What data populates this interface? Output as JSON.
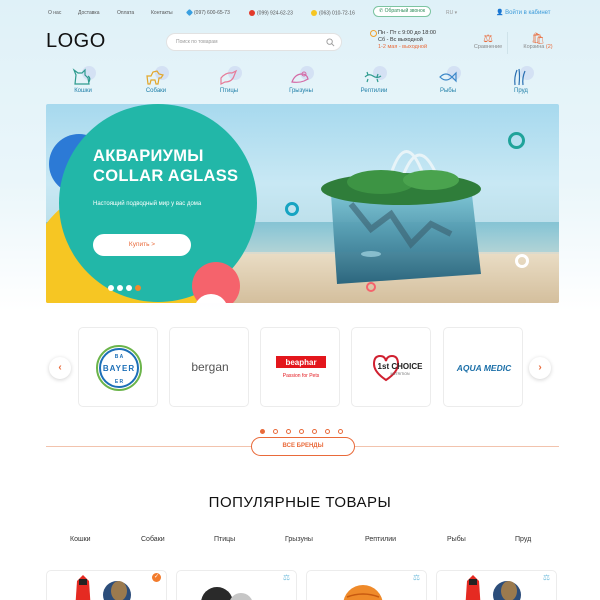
{
  "topbar": {
    "links": [
      "О нас",
      "Доставка",
      "Оплата",
      "Контакты"
    ],
    "phones": [
      "(097) 600-65-73",
      "(099) 924-62-23",
      "(063) 010-72-16"
    ],
    "callback": "Обратный звонок",
    "lang": "RU",
    "login": "Войти в кабинет"
  },
  "header": {
    "logo": "LOGO",
    "search_placeholder": "Поиск по товарам",
    "hours": [
      "Пн - Пт с 9:00 до 18:00",
      "Сб - Вс выходной"
    ],
    "hours_note": "1-2 мая - выходной",
    "compare_label": "Сравнение",
    "cart_label": "Корзина",
    "cart_count": "(2)"
  },
  "categories": [
    {
      "label": "Кошки",
      "icon": "cat-icon"
    },
    {
      "label": "Собаки",
      "icon": "dog-icon"
    },
    {
      "label": "Птицы",
      "icon": "bird-icon"
    },
    {
      "label": "Грызуны",
      "icon": "rodent-icon"
    },
    {
      "label": "Рептилии",
      "icon": "reptile-icon"
    },
    {
      "label": "Рыбы",
      "icon": "fish-icon"
    },
    {
      "label": "Пруд",
      "icon": "pond-icon"
    }
  ],
  "hero": {
    "title_line1": "АКВАРИУМЫ",
    "title_line2": "COLLAR AGLASS",
    "subtitle": "Настоящий подводный мир у вас дома",
    "button": "Купить >",
    "slides": 4,
    "active_slide": 4
  },
  "brands": {
    "items": [
      {
        "name": "bayer",
        "text": "BAYER"
      },
      {
        "name": "bergan",
        "text": "bergan"
      },
      {
        "name": "beaphar",
        "text": "beaphar",
        "tagline": "Passion for Pets"
      },
      {
        "name": "1st-choice",
        "text": "1st CHOICE",
        "tagline": "NUTRITION"
      },
      {
        "name": "aqua-medic",
        "text": "AQUA MEDIC"
      }
    ],
    "pages": 7,
    "active_page": 1,
    "all_button": "ВСЕ БРЕНДЫ"
  },
  "popular": {
    "title": "ПОПУЛЯРНЫЕ ТОВАРЫ",
    "tabs": [
      "Кошки",
      "Собаки",
      "Птицы",
      "Грызуны",
      "Рептилии",
      "Рыбы",
      "Пруд"
    ]
  },
  "colors": {
    "accent": "#e96a3a",
    "link": "#3a9ad9",
    "hero_teal": "#22b7a8",
    "hero_yellow": "#f6c623",
    "hero_blue": "#2c7ad6",
    "hero_pink": "#f5636c"
  }
}
